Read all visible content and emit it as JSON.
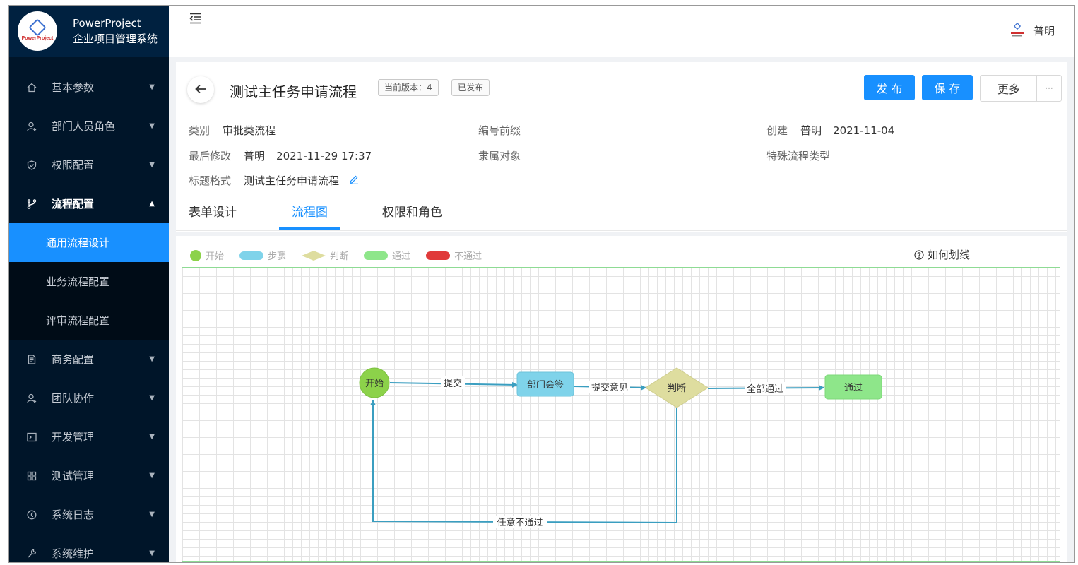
{
  "app": {
    "name": "PowerProject",
    "subtitle": "企业项目管理系统",
    "logo_text": "PowerProject"
  },
  "sidebar": {
    "items": [
      {
        "label": "基本参数",
        "icon": "home-icon"
      },
      {
        "label": "部门人员角色",
        "icon": "users-icon"
      },
      {
        "label": "权限配置",
        "icon": "shield-icon"
      },
      {
        "label": "流程配置",
        "icon": "branch-icon",
        "open": true
      },
      {
        "label": "商务配置",
        "icon": "document-icon"
      },
      {
        "label": "团队协作",
        "icon": "team-icon"
      },
      {
        "label": "开发管理",
        "icon": "terminal-icon"
      },
      {
        "label": "测试管理",
        "icon": "grid-icon"
      },
      {
        "label": "系统日志",
        "icon": "clock-icon"
      },
      {
        "label": "系统维护",
        "icon": "wrench-icon"
      }
    ],
    "submenu": [
      {
        "label": "通用流程设计",
        "active": true
      },
      {
        "label": "业务流程配置"
      },
      {
        "label": "评审流程配置"
      }
    ]
  },
  "header": {
    "user_name": "普明"
  },
  "page": {
    "title": "测试主任务申请流程",
    "version_tag": "当前版本：4",
    "status_tag": "已发布",
    "buttons": {
      "publish": "发 布",
      "save": "保 存",
      "more": "更多",
      "ellipsis": "···"
    },
    "meta": {
      "category_label": "类别",
      "category_value": "审批类流程",
      "prefix_label": "编号前缀",
      "created_label": "创建",
      "created_user": "普明",
      "created_date": "2021-11-04",
      "modified_label": "最后修改",
      "modified_user": "普明",
      "modified_date": "2021-11-29 17:37",
      "owner_label": "隶属对象",
      "special_label": "特殊流程类型",
      "title_format_label": "标题格式",
      "title_format_value": "测试主任务申请流程"
    },
    "tabs": [
      "表单设计",
      "流程图",
      "权限和角色"
    ],
    "active_tab": "流程图"
  },
  "diagram": {
    "legend": [
      {
        "label": "开始",
        "color": "#8cd24a"
      },
      {
        "label": "步骤",
        "color": "#7fd3ea"
      },
      {
        "label": "判断",
        "color": "#dedd9f"
      },
      {
        "label": "通过",
        "color": "#8ee68a"
      },
      {
        "label": "不通过",
        "color": "#e03a3a"
      }
    ],
    "howto": "如何划线",
    "nodes": {
      "start": "开始",
      "step": "部门会签",
      "decision": "判断",
      "pass": "通过"
    },
    "edges": {
      "submit": "提交",
      "submit_opinion": "提交意见",
      "all_pass": "全部通过",
      "any_fail": "任意不通过"
    }
  }
}
